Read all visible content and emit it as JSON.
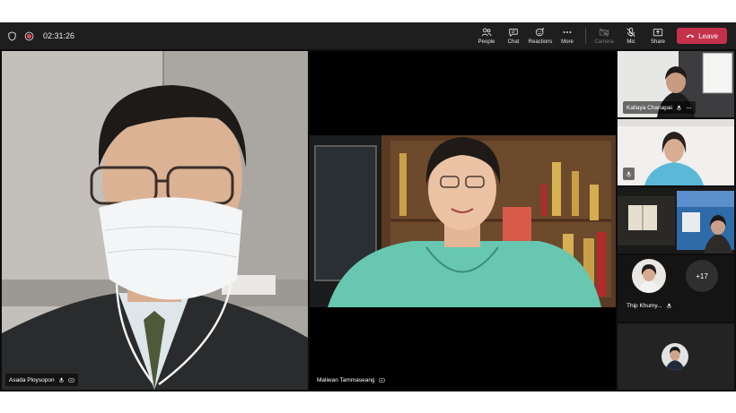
{
  "toolbar": {
    "timer": "02:31:26",
    "controls": [
      {
        "label": "People",
        "icon": "people-icon"
      },
      {
        "label": "Chat",
        "icon": "chat-icon"
      },
      {
        "label": "Reactions",
        "icon": "reactions-icon"
      },
      {
        "label": "More",
        "icon": "more-icon"
      },
      {
        "label": "Camera",
        "icon": "camera-off-icon",
        "disabled": true
      },
      {
        "label": "Mic",
        "icon": "mic-off-icon"
      },
      {
        "label": "Share",
        "icon": "share-icon"
      }
    ],
    "leave_label": "Leave",
    "leave_color": "#c4314b"
  },
  "participants": {
    "main_left": {
      "name": "Asada Ploysopon"
    },
    "main_center": {
      "name": "Maliwan Tammaseang"
    },
    "side_top": {
      "name": "Kallaya Chanapai"
    },
    "thip": {
      "name": "Thip Khumy..."
    },
    "overflow_count": "+17"
  }
}
